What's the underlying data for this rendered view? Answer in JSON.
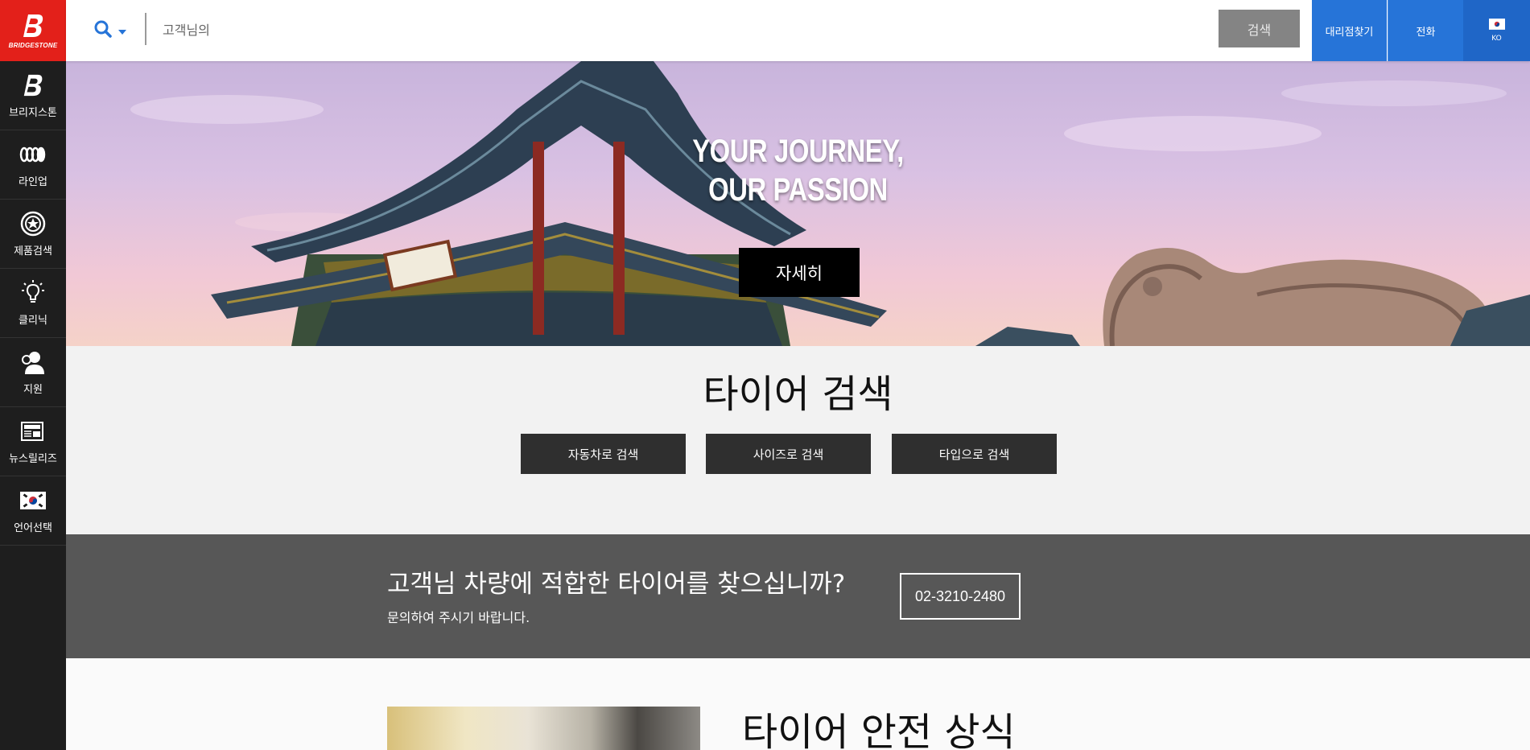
{
  "brand": {
    "name": "BRIDGESTONE",
    "color": "#e3201a"
  },
  "sidebar": {
    "items": [
      {
        "label": "브리지스톤",
        "icon": "bridgestone-b-icon"
      },
      {
        "label": "라인업",
        "icon": "tires-icon"
      },
      {
        "label": "제품검색",
        "icon": "wheel-icon"
      },
      {
        "label": "클리닉",
        "icon": "lightbulb-icon"
      },
      {
        "label": "지원",
        "icon": "support-user-icon"
      },
      {
        "label": "뉴스릴리즈",
        "icon": "newspaper-icon"
      },
      {
        "label": "언어선택",
        "icon": "korea-flag-icon"
      }
    ]
  },
  "header": {
    "search_placeholder": "고객님의",
    "search_button": "검색",
    "dealer_label": "대리점찾기",
    "phone_label": "전화",
    "lang_code": "KO",
    "accent_color": "#2674d8"
  },
  "hero": {
    "title_line1": "YOUR JOURNEY,",
    "title_line2": "OUR PASSION",
    "button_label": "자세히"
  },
  "tire_search": {
    "title": "타이어 검색",
    "buttons": [
      "자동차로 검색",
      "사이즈로 검색",
      "타입으로 검색"
    ]
  },
  "contact": {
    "title": "고객님 차량에 적합한 타이어를 찾으십니까?",
    "subtitle": "문의하여 주시기 바랍니다.",
    "phone": "02-3210-2480"
  },
  "safety": {
    "title": "타이어 안전 상식"
  }
}
